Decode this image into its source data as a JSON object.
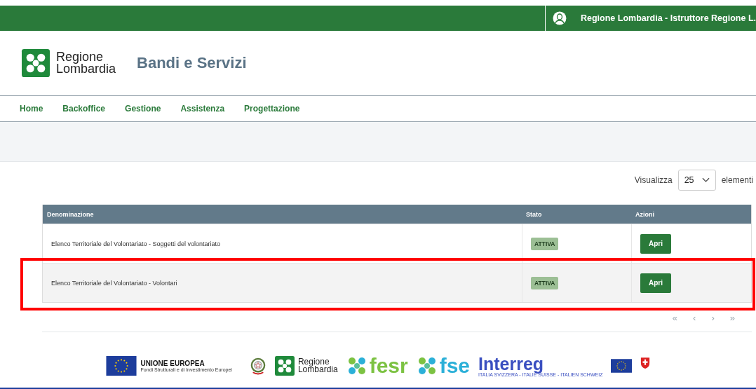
{
  "top_bar": {
    "user": "Regione Lombardia - Istruttore Regione L."
  },
  "header": {
    "logo_line_1": "Regione",
    "logo_line_2": "Lombardia",
    "title": "Bandi e Servizi"
  },
  "nav": [
    {
      "label": "Home"
    },
    {
      "label": "Backoffice"
    },
    {
      "label": "Gestione"
    },
    {
      "label": "Assistenza"
    },
    {
      "label": "Progettazione"
    }
  ],
  "page_size": {
    "label_before": "Visualizza",
    "value": "25",
    "label_after": "elementi"
  },
  "table": {
    "columns": [
      "Denominazione",
      "Stato",
      "Azioni"
    ],
    "rows": [
      {
        "name": "Elenco Territoriale del Volontariato - Soggetti del volontariato",
        "status": "ATTIVA",
        "action": "Apri",
        "highlighted": false
      },
      {
        "name": "Elenco Territoriale del Volontariato - Volontari",
        "status": "ATTIVA",
        "action": "Apri",
        "highlighted": true
      }
    ]
  },
  "pagination": [
    "«",
    "‹",
    "›",
    "»"
  ],
  "footer": {
    "eu_title": "UNIONE EUROPEA",
    "eu_subtitle": "Fondi Strutturali e di Investimento Europei",
    "rl_line_1": "Regione",
    "rl_line_2": "Lombardia",
    "fesr": "fesr",
    "fse": "fse",
    "interreg": "Interreg",
    "interreg_subtitle": "ITALIA SVIZZERA - ITALIE SUISSE - ITALIEN SCHWEIZ"
  }
}
